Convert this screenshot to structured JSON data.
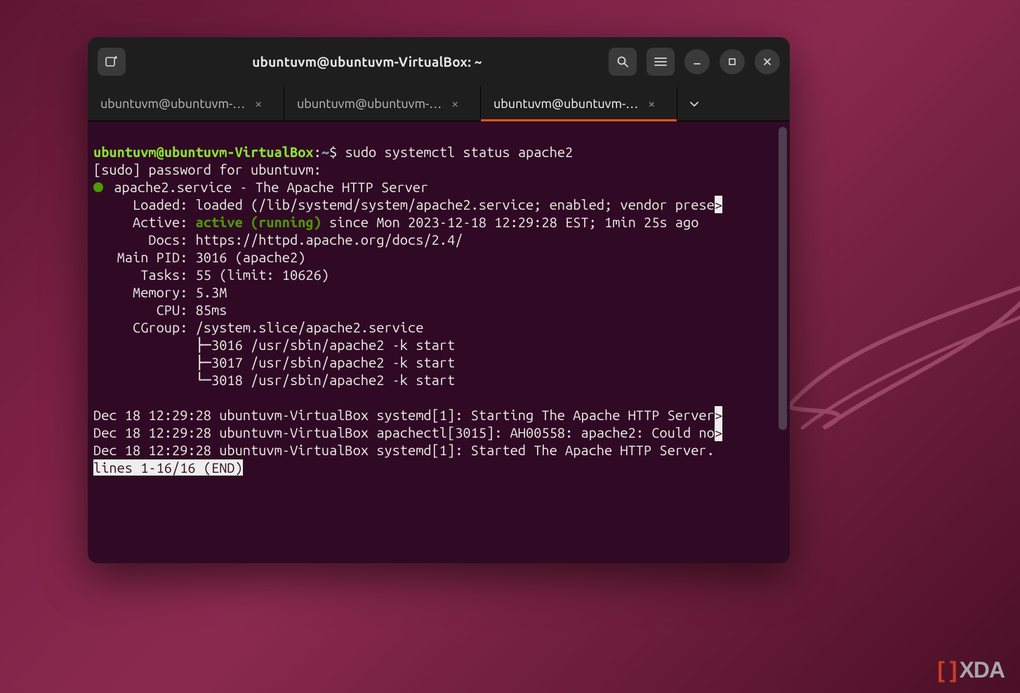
{
  "window": {
    "title": "ubuntuvm@ubuntuvm-VirtualBox: ~"
  },
  "tabs": {
    "t0": {
      "label": "ubuntuvm@ubuntuvm-…"
    },
    "t1": {
      "label": "ubuntuvm@ubuntuvm-…"
    },
    "t2": {
      "label": "ubuntuvm@ubuntuvm-…"
    }
  },
  "prompt": {
    "user": "ubuntuvm",
    "at": "@",
    "host": "ubuntuvm-VirtualBox",
    "sep": ":",
    "path": "~",
    "sym": "$ ",
    "command": "sudo systemctl status apache2"
  },
  "out": {
    "sudo_pw": "[sudo] password for ubuntuvm:",
    "svc_head": " apache2.service - The Apache HTTP Server",
    "loaded": "     Loaded: loaded (/lib/systemd/system/apache2.service; enabled; vendor prese",
    "active_l": "     Active: ",
    "active_g": "active (running)",
    "active_r": " since Mon 2023-12-18 12:29:28 EST; 1min 25s ago",
    "docs": "       Docs: https://httpd.apache.org/docs/2.4/",
    "pid": "   Main PID: 3016 (apache2)",
    "tasks": "      Tasks: 55 (limit: 10626)",
    "mem": "     Memory: 5.3M",
    "cpu": "        CPU: 85ms",
    "cgrp": "     CGroup: /system.slice/apache2.service",
    "p1": "             ├─3016 /usr/sbin/apache2 -k start",
    "p2": "             ├─3017 /usr/sbin/apache2 -k start",
    "p3": "             └─3018 /usr/sbin/apache2 -k start",
    "blank": "",
    "log1": "Dec 18 12:29:28 ubuntuvm-VirtualBox systemd[1]: Starting The Apache HTTP Server",
    "log2": "Dec 18 12:29:28 ubuntuvm-VirtualBox apachectl[3015]: AH00558: apache2: Could no",
    "log3": "Dec 18 12:29:28 ubuntuvm-VirtualBox systemd[1]: Started The Apache HTTP Server.",
    "end": "lines 1-16/16 (END)",
    "gt": ">"
  },
  "watermark": {
    "left": "[ ]",
    "text": "XDA"
  }
}
